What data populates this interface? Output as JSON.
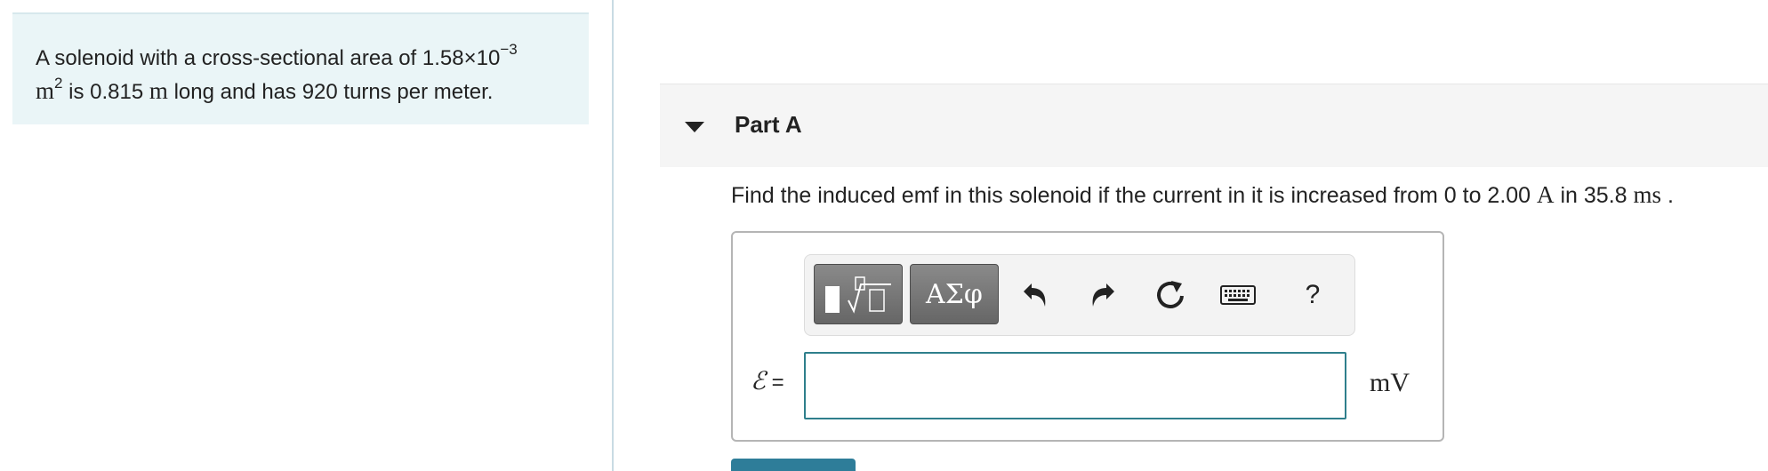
{
  "context": {
    "text_1": "A solenoid with a cross-sectional area of 1.58×10",
    "exp_1": "−3",
    "unit_m": "m",
    "exp_2": "2",
    "text_2": " is 0.815 ",
    "unit_m2": "m",
    "text_3": " long and has 920 turns per meter."
  },
  "part": {
    "title": "Part A"
  },
  "question": {
    "text_1": "Find the induced emf in this solenoid if the current in it is increased from 0 to 2.00 ",
    "unit_A": "A",
    "text_2": " in 35.8 ",
    "unit_ms": "ms",
    "text_3": " ."
  },
  "toolbar": {
    "greek_label": "ΑΣφ",
    "help_label": "?",
    "icons": [
      "templates-icon",
      "greek-symbols-icon",
      "undo-icon",
      "redo-icon",
      "reset-icon",
      "keyboard-icon",
      "help-icon"
    ]
  },
  "answer": {
    "symbol": "ℰ",
    "equals": " =",
    "value": "",
    "unit": "mV"
  },
  "colors": {
    "context_bg": "#eaf5f7",
    "input_border": "#2f7f8c",
    "submit_bg": "#2e7d99"
  }
}
